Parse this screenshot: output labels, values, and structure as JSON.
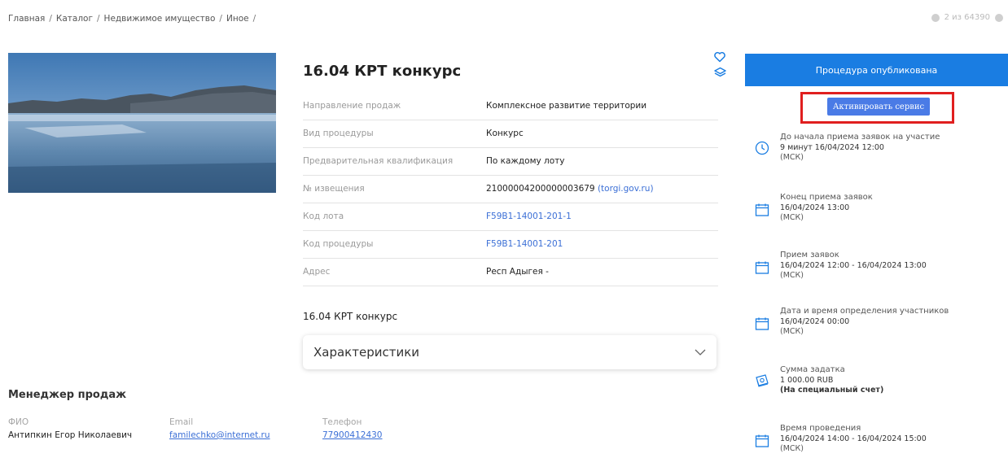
{
  "breadcrumb": [
    "Главная",
    "Каталог",
    "Недвижимое имущество",
    "Иное"
  ],
  "pager": {
    "text": "2 из 64390"
  },
  "lot": {
    "title": "16.04 КРТ конкурс",
    "subtitle": "16.04 КРТ конкурс",
    "properties": [
      {
        "label": "Направление продаж",
        "value": "Комплексное развитие территории",
        "extra": ""
      },
      {
        "label": "Вид процедуры",
        "value": "Конкурс",
        "extra": ""
      },
      {
        "label": "Предварительная квалификация",
        "value": "По каждому лоту",
        "extra": ""
      },
      {
        "label": "№ извещения",
        "value": "21000004200000003679",
        "extra": "(torgi.gov.ru)"
      },
      {
        "label": "Код лота",
        "value": "F59B1-14001-201-1",
        "extra": ""
      },
      {
        "label": "Код процедуры",
        "value": "F59B1-14001-201",
        "extra": ""
      },
      {
        "label": "Адрес",
        "value": "Респ Адыгея -",
        "extra": ""
      }
    ],
    "accordion_label": "Характеристики"
  },
  "manager": {
    "title": "Менеджер продаж",
    "fio_label": "ФИО",
    "fio": "Антипкин Егор Николаевич",
    "email_label": "Email",
    "email": "familechko@internet.ru",
    "phone_label": "Телефон",
    "phone": "77900412430"
  },
  "sidebar": {
    "status": "Процедура опубликована",
    "activate_button": "Активировать сервис",
    "events": [
      {
        "icon": "clock-icon",
        "title": "До начала приема заявок на участие",
        "line2": "9 минут 16/04/2024 12:00",
        "line3": "(МСК)",
        "bold": false
      },
      {
        "icon": "calendar-icon",
        "title": "Конец приема заявок",
        "line2": "16/04/2024 13:00",
        "line3": "(МСК)",
        "bold": false
      },
      {
        "icon": "calendar-icon",
        "title": "Прием заявок",
        "line2": "16/04/2024 12:00 - 16/04/2024 13:00",
        "line3": "(МСК)",
        "bold": false
      },
      {
        "icon": "calendar-icon",
        "title": "Дата и время определения участников",
        "line2": "16/04/2024 00:00",
        "line3": "(МСК)",
        "bold": false
      },
      {
        "icon": "money-icon",
        "title": "Сумма задатка",
        "line2": "1 000.00 RUB",
        "line3": "(На специальный счет)",
        "bold": true
      },
      {
        "icon": "calendar-icon",
        "title": "Время проведения",
        "line2": "16/04/2024 14:00 - 16/04/2024 15:00",
        "line3": "(МСК)",
        "bold": false
      }
    ]
  },
  "colors": {
    "accent": "#1a7de2",
    "button": "#4a7be6",
    "highlight": "#e01f1f",
    "link": "#3b6fd6"
  }
}
